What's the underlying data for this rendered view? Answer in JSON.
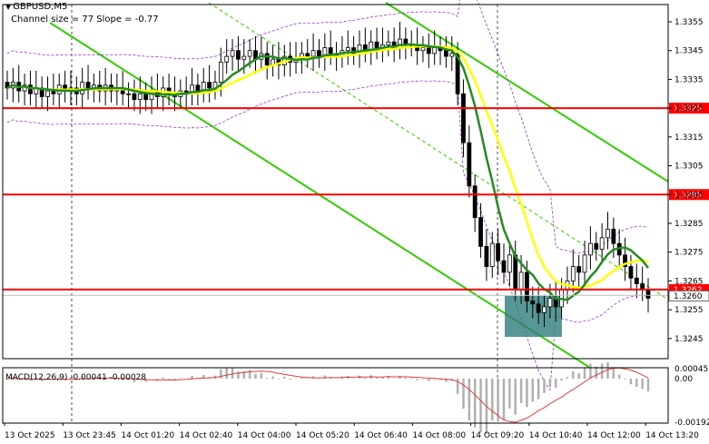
{
  "header": {
    "symbol": "GBPUSD,M5",
    "channel_info": "Channel size = 77 Slope = -0.77"
  },
  "macd_label": "MACD(12,26,9) -0.00041 -0.00028",
  "chart_data": {
    "type": "candlestick",
    "main_y_ticks": [
      "1.3355",
      "1.3345",
      "1.3335",
      "1.3325",
      "1.3315",
      "1.3305",
      "1.3295",
      "1.3285",
      "1.3275",
      "1.3265",
      "1.3255",
      "1.3245"
    ],
    "main_ylim": [
      1.3238,
      1.3361
    ],
    "horizontal_lines": [
      {
        "value": 1.3325,
        "label": "1.3325",
        "color": "#ff0000"
      },
      {
        "value": 1.3295,
        "label": "1.3295",
        "color": "#ff0000"
      },
      {
        "value": 1.3262,
        "label": "1.3262",
        "color": "#ff0000"
      }
    ],
    "bid_line": {
      "value": 1.326,
      "label": "1.3260"
    },
    "price_labels_color": "#ff0000",
    "macd_y_ticks": [
      "0.00045",
      "0.00",
      "-0.00192"
    ],
    "macd_ylim": [
      -0.00195,
      0.00048
    ],
    "macd": {
      "main": -0.00041,
      "signal": -0.00028
    },
    "x_labels": [
      "13 Oct 2025",
      "13 Oct 23:45",
      "14 Oct 01:20",
      "14 Oct 02:40",
      "14 Oct 04:00",
      "14 Oct 05:20",
      "14 Oct 06:40",
      "14 Oct 08:00",
      "14 Oct 09:20",
      "14 Oct 10:40",
      "14 Oct 12:00",
      "14 Oct 13:20"
    ],
    "candle_count": 111,
    "closes": [
      1.3332,
      1.3334,
      1.3331,
      1.3333,
      1.333,
      1.3332,
      1.3329,
      1.3331,
      1.333,
      1.3333,
      1.3331,
      1.3332,
      1.333,
      1.3334,
      1.3332,
      1.3333,
      1.3331,
      1.3333,
      1.3331,
      1.3332,
      1.333,
      1.333,
      1.3328,
      1.333,
      1.3328,
      1.3331,
      1.3329,
      1.3332,
      1.333,
      1.3329,
      1.3331,
      1.333,
      1.3333,
      1.3331,
      1.3334,
      1.3332,
      1.3334,
      1.3341,
      1.3343,
      1.3345,
      1.3342,
      1.3343,
      1.3345,
      1.3342,
      1.3344,
      1.334,
      1.3342,
      1.334,
      1.3343,
      1.3341,
      1.3342,
      1.3344,
      1.3343,
      1.3345,
      1.3343,
      1.3346,
      1.3344,
      1.3343,
      1.3345,
      1.3346,
      1.3344,
      1.3347,
      1.3345,
      1.3348,
      1.3346,
      1.3347,
      1.3348,
      1.3346,
      1.3349,
      1.3347,
      1.3347,
      1.3345,
      1.3346,
      1.3344,
      1.3346,
      1.3345,
      1.3343,
      1.3344,
      1.333,
      1.3313,
      1.3298,
      1.3287,
      1.3277,
      1.327,
      1.3278,
      1.3272,
      1.3268,
      1.3274,
      1.3262,
      1.3268,
      1.3258,
      1.3257,
      1.3254,
      1.3256,
      1.3259,
      1.3256,
      1.3262,
      1.3265,
      1.327,
      1.3268,
      1.3274,
      1.3278,
      1.3276,
      1.328,
      1.3283,
      1.3278,
      1.3274,
      1.327,
      1.3266,
      1.3264,
      1.3262,
      1.3259
    ],
    "ma_green_label": "",
    "ma_yellow_label": "",
    "colors": {
      "green_ma": "#228b22",
      "yellow_ma": "#ffff00",
      "channel": "#33cc00",
      "box": "#2e7d7a",
      "macd_signal": "#e04040",
      "macd_hist": "#b0b0b0",
      "bollinger": "#9932cc"
    }
  }
}
